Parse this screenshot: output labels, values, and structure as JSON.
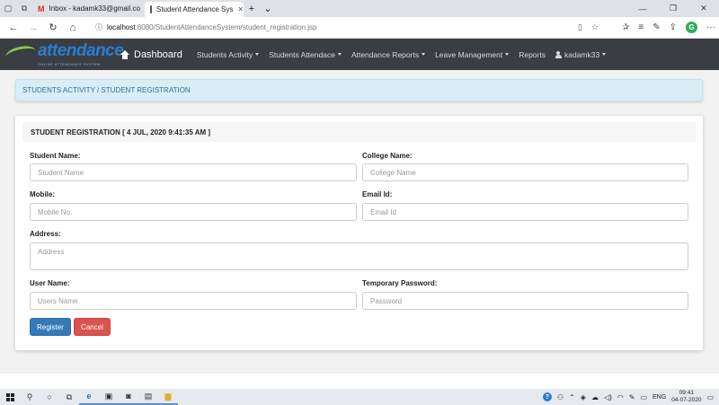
{
  "browser": {
    "tabs": [
      {
        "title": "Inbox - kadamk33@gmail.co",
        "icon": "gmail-icon"
      },
      {
        "title": "Student Attendance Sys",
        "icon": "page-icon"
      }
    ],
    "url_host": "localhost",
    "url_path": ":8080/StudentAttendanceSystem/student_registration.jsp",
    "profile_initial": "G"
  },
  "navbar": {
    "logo_text": "attendance",
    "logo_subtext": "ONLINE ATTENDANCE SYSTEM",
    "brand": "Dashboard",
    "menu": [
      {
        "label": "Students Activity"
      },
      {
        "label": "Students Attendace"
      },
      {
        "label": "Attendance Reports"
      },
      {
        "label": "Leave Management"
      },
      {
        "label": "Reports"
      },
      {
        "label": "kadamk33"
      }
    ],
    "colors": {
      "background": "#3a3d42",
      "logo": "#2a7ed3",
      "swoosh": "#8bc34a"
    }
  },
  "breadcrumb": "STUDENTS ACTIVITY / STUDENT REGISTRATION",
  "form": {
    "title": "STUDENT REGISTRATION  [ 4 JUL, 2020 9:41:35 AM ]",
    "student_name": {
      "label": "Student Name:",
      "placeholder": "Student Name"
    },
    "college_name": {
      "label": "College Name:",
      "placeholder": "College Name"
    },
    "mobile": {
      "label": "Mobile:",
      "placeholder": "Mobile No."
    },
    "email": {
      "label": "Email Id:",
      "placeholder": "Email Id"
    },
    "address": {
      "label": "Address:",
      "placeholder": "Address"
    },
    "user_name": {
      "label": "User Name:",
      "placeholder": "Users Name"
    },
    "password": {
      "label": "Temporary Password:",
      "placeholder": "Password"
    },
    "register_label": "Register",
    "cancel_label": "Cancel"
  },
  "taskbar": {
    "language": "ENG",
    "time": "09:41",
    "date": "04-07-2020"
  }
}
